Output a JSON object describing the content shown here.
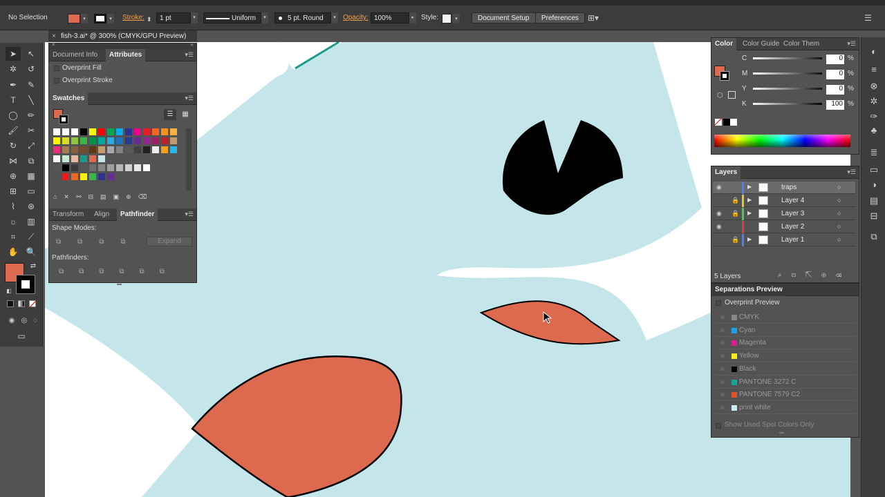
{
  "control_bar": {
    "selection": "No Selection",
    "stroke_label": "Stroke:",
    "stroke_weight": "1 pt",
    "profile": "Uniform",
    "brush": "5 pt. Round",
    "opacity_label": "Opacity:",
    "opacity": "100%",
    "style_label": "Style:",
    "document_setup": "Document Setup",
    "preferences": "Preferences"
  },
  "document": {
    "tab_title": "fish-3.ai* @ 300% (CMYK/GPU Preview)"
  },
  "attributes_panel": {
    "tabs": [
      "Document Info",
      "Attributes"
    ],
    "overprint_fill": "Overprint Fill",
    "overprint_stroke": "Overprint Stroke"
  },
  "swatches_panel": {
    "title": "Swatches"
  },
  "pathfinder_panel": {
    "tabs": [
      "Transform",
      "Align",
      "Pathfinder"
    ],
    "shape_modes": "Shape Modes:",
    "expand": "Expand",
    "pathfinders": "Pathfinders:"
  },
  "color_panel": {
    "tabs": [
      "Color",
      "Color Guide",
      "Color Them"
    ],
    "channels": [
      {
        "label": "C",
        "value": "0"
      },
      {
        "label": "M",
        "value": "0"
      },
      {
        "label": "Y",
        "value": "0"
      },
      {
        "label": "K",
        "value": "100"
      }
    ],
    "percent": "%"
  },
  "layers_panel": {
    "title": "Layers",
    "layers": [
      {
        "name": "traps",
        "selected": true,
        "color": "#4f7cff"
      },
      {
        "name": "Layer 4",
        "selected": false,
        "color": "#e8c72e"
      },
      {
        "name": "Layer 3",
        "selected": false,
        "color": "#3fd14a"
      },
      {
        "name": "Layer 2",
        "selected": false,
        "color": "#e53b3b"
      },
      {
        "name": "Layer 1",
        "selected": false,
        "color": "#4f7cff"
      }
    ],
    "count": "5 Layers"
  },
  "separations_panel": {
    "title": "Separations Preview",
    "overprint_preview": "Overprint Preview",
    "plates": [
      {
        "name": "CMYK",
        "color": "#888888"
      },
      {
        "name": "Cyan",
        "color": "#1aa3e0"
      },
      {
        "name": "Magenta",
        "color": "#d6218a"
      },
      {
        "name": "Yellow",
        "color": "#f4ee1c"
      },
      {
        "name": "Black",
        "color": "#000000"
      },
      {
        "name": "PANTONE 3272 C",
        "color": "#17a597"
      },
      {
        "name": "PANTONE 7579 C2",
        "color": "#e0522a"
      },
      {
        "name": "print white",
        "color": "#c8ecf2"
      }
    ],
    "show_used": "Show Used Spot Colors Only"
  },
  "colors": {
    "fish_body": "#c4e6ea",
    "fin": "#dd6a4f",
    "eye": "#000000",
    "teal_stroke": "#1a9a8a"
  }
}
